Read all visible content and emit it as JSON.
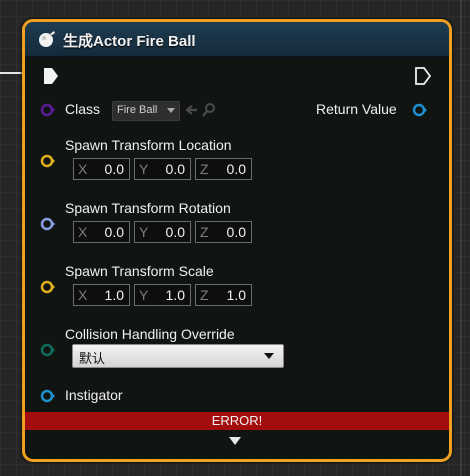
{
  "node": {
    "title": "生成Actor Fire Ball",
    "error_text": "ERROR!"
  },
  "pins": {
    "class": {
      "label": "Class",
      "selected_value": "Fire Ball",
      "color": "#5a1a9a"
    },
    "return_value": {
      "label": "Return Value",
      "color": "#1e90d0"
    },
    "spawn_location": {
      "label": "Spawn Transform Location",
      "x_axis": "X",
      "x": "0.0",
      "y_axis": "Y",
      "y": "0.0",
      "z_axis": "Z",
      "z": "0.0",
      "color": "#e0b020"
    },
    "spawn_rotation": {
      "label": "Spawn Transform Rotation",
      "x_axis": "X",
      "x": "0.0",
      "y_axis": "Y",
      "y": "0.0",
      "z_axis": "Z",
      "z": "0.0",
      "color": "#8a9ce0"
    },
    "spawn_scale": {
      "label": "Spawn Transform Scale",
      "x_axis": "X",
      "x": "1.0",
      "y_axis": "Y",
      "y": "1.0",
      "z_axis": "Z",
      "z": "1.0",
      "color": "#e0b020"
    },
    "collision": {
      "label": "Collision Handling Override",
      "selected_value": "默认",
      "color": "#0e6d5e"
    },
    "instigator": {
      "label": "Instigator",
      "color": "#1e90d0"
    }
  },
  "colors": {
    "node_border": "#f0a020",
    "header": "#1f3d52",
    "error": "#a30d0d"
  }
}
